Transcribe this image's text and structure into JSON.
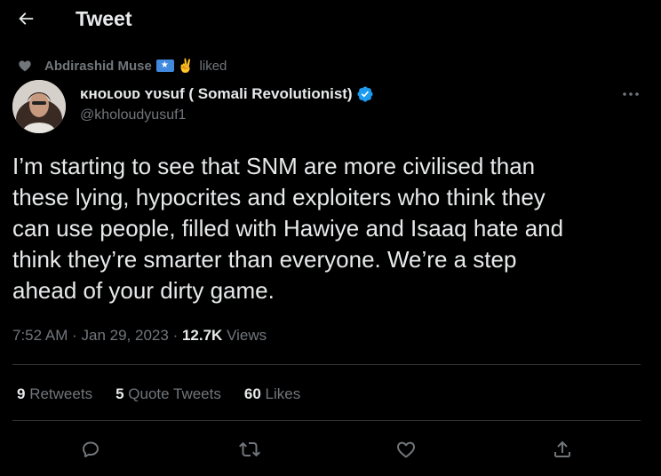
{
  "header": {
    "title": "Tweet",
    "back_icon": "arrow-left-icon"
  },
  "social_context": {
    "user": "Abdirashid Muse",
    "action": "liked",
    "emoji": "✌️"
  },
  "author": {
    "name": "ᴋʜᴏʟᴏᴜᴅ ʏᴜsuf ( Somali Revolutionist)",
    "handle": "@kholoudyusuf1",
    "verified": true
  },
  "tweet": {
    "text": "I’m starting to see that SNM are more civilised than\nthese lying, hypocrites and exploiters who think they\ncan use people, filled with Hawiye and Isaaq hate and\nthink they’re smarter than everyone. We’re a step\nahead of your dirty game.",
    "time": "7:52 AM",
    "separator": "·",
    "date": "Jan 29, 2023",
    "views_count": "12.7K",
    "views_label": "Views"
  },
  "stats": {
    "retweets_count": "9",
    "retweets_label": "Retweets",
    "quotes_count": "5",
    "quotes_label": "Quote Tweets",
    "likes_count": "60",
    "likes_label": "Likes"
  },
  "colors": {
    "background": "#000000",
    "text": "#e7e9ea",
    "secondary": "#71767b",
    "verified": "#1d9bf0",
    "divider": "#2f3336"
  }
}
